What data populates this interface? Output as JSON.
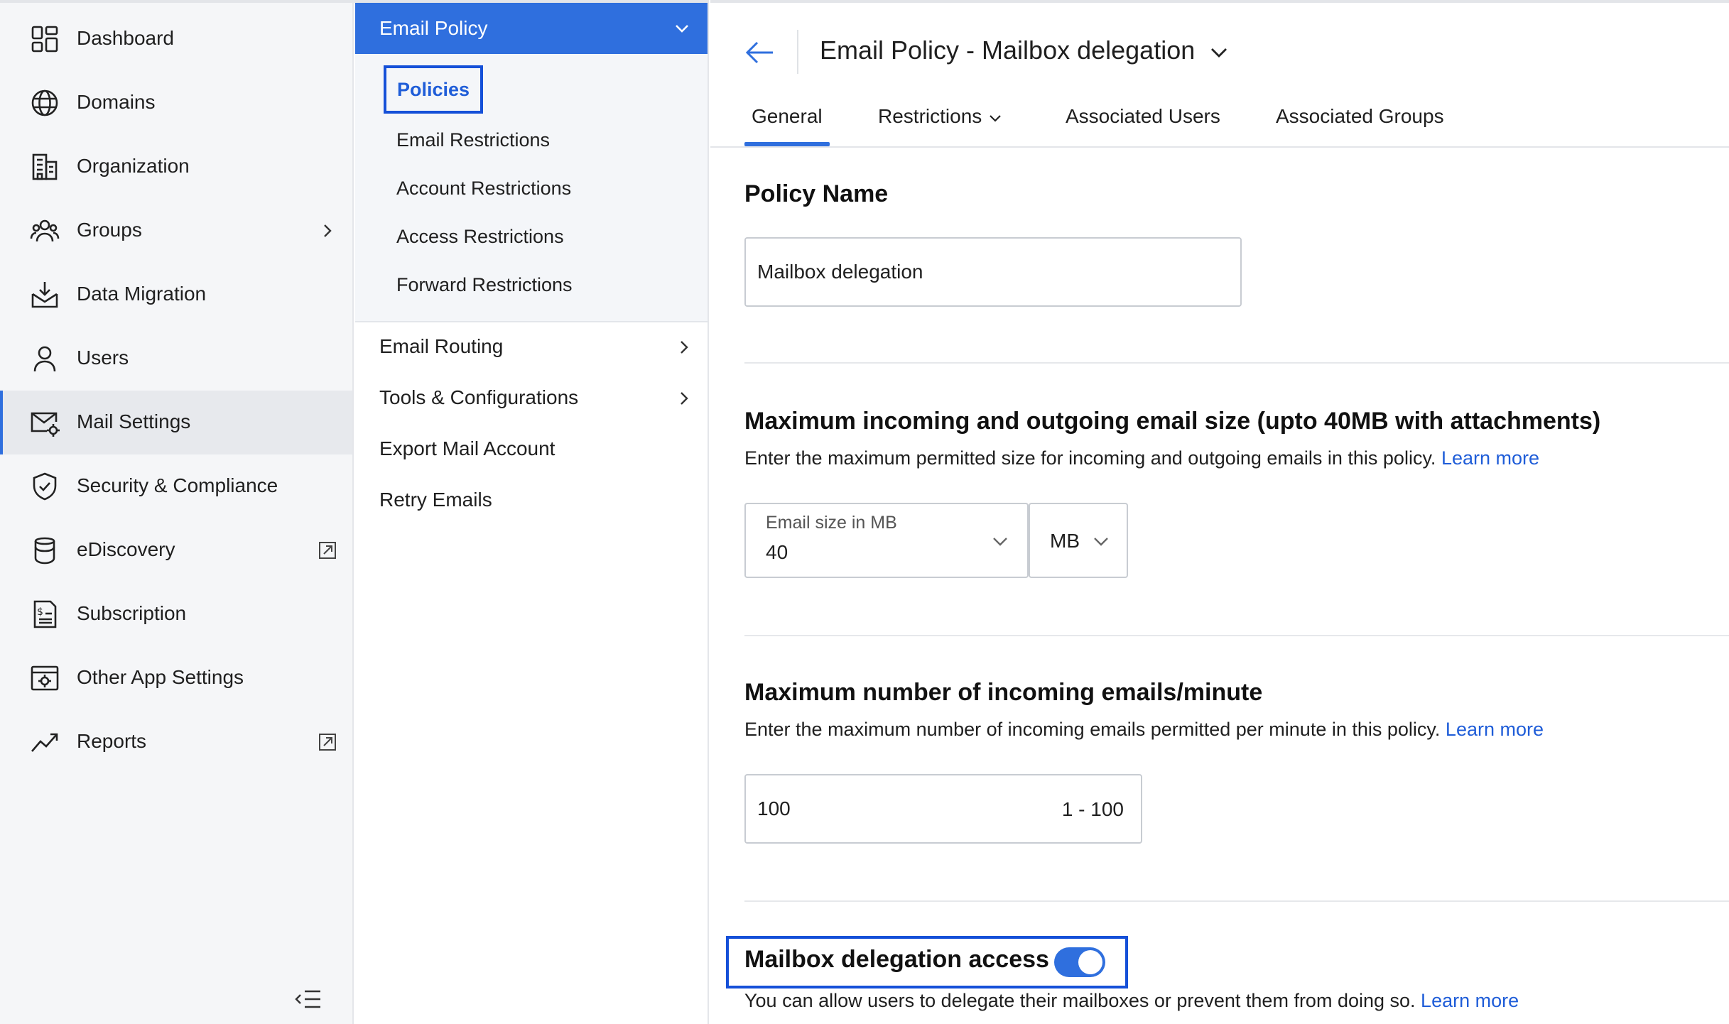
{
  "colors": {
    "accent": "#2f6fde",
    "highlight": "#1550d8",
    "link": "#1f5dd8",
    "nav_bg": "#f5f6f8"
  },
  "sidebar": {
    "items": [
      {
        "label": "Dashboard",
        "icon": "dashboard-icon"
      },
      {
        "label": "Domains",
        "icon": "globe-icon"
      },
      {
        "label": "Organization",
        "icon": "building-icon"
      },
      {
        "label": "Groups",
        "icon": "users-group-icon",
        "trailing": "chevron-right-icon"
      },
      {
        "label": "Data Migration",
        "icon": "inbox-download-icon"
      },
      {
        "label": "Users",
        "icon": "user-icon"
      },
      {
        "label": "Mail Settings",
        "icon": "mail-settings-icon",
        "active": true
      },
      {
        "label": "Security & Compliance",
        "icon": "shield-check-icon"
      },
      {
        "label": "eDiscovery",
        "icon": "ediscovery-icon",
        "trailing": "external-link-icon"
      },
      {
        "label": "Subscription",
        "icon": "invoice-icon"
      },
      {
        "label": "Other App Settings",
        "icon": "app-settings-icon"
      },
      {
        "label": "Reports",
        "icon": "trend-icon",
        "trailing": "external-link-icon"
      }
    ],
    "collapse_icon": "collapse-menu-icon"
  },
  "submenu": {
    "header": "Email Policy",
    "children": [
      "Policies",
      "Email Restrictions",
      "Account Restrictions",
      "Access Restrictions",
      "Forward Restrictions"
    ],
    "items": [
      {
        "label": "Email Routing",
        "has_arrow": true
      },
      {
        "label": "Tools & Configurations",
        "has_arrow": true
      },
      {
        "label": "Export Mail Account",
        "has_arrow": false
      },
      {
        "label": "Retry Emails",
        "has_arrow": false
      }
    ]
  },
  "main": {
    "title": "Email Policy - Mailbox delegation",
    "tabs": [
      "General",
      "Restrictions",
      "Associated Users",
      "Associated Groups"
    ],
    "active_tab": "General",
    "policy_name": {
      "title": "Policy Name",
      "value": "Mailbox delegation"
    },
    "email_size": {
      "title": "Maximum incoming and outgoing email size (upto 40MB with attachments)",
      "desc": "Enter the maximum permitted size for incoming and outgoing emails in this policy.",
      "link": "Learn more",
      "field_label": "Email size in MB",
      "field_value": "40",
      "unit": "MB"
    },
    "incoming_rate": {
      "title": "Maximum number of incoming emails/minute",
      "desc": "Enter the maximum number of incoming emails permitted per minute in this policy.",
      "link": "Learn more",
      "value": "100",
      "range": "1 - 100"
    },
    "delegation": {
      "title": "Mailbox delegation access",
      "enabled": true,
      "desc": "You can allow users to delegate their mailboxes or prevent them from doing so.",
      "link": "Learn more"
    }
  }
}
